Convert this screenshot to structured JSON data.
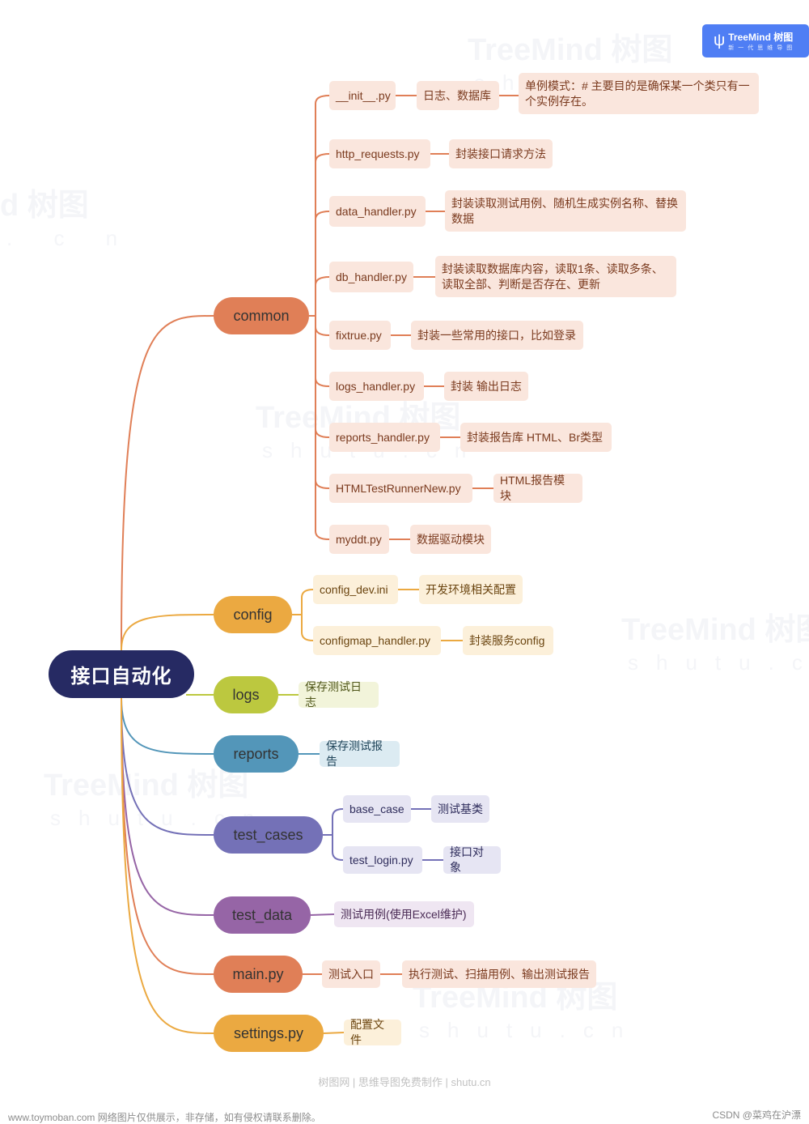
{
  "badge": {
    "brand": "TreeMind 树图",
    "tagline": "新一代思维导图",
    "icon": "treemind-logo-icon"
  },
  "watermark": {
    "brand": "TreeMind 树图",
    "domain": "shutu.cn",
    "partial_brand": "d 树图",
    "partial_domain": ". c n"
  },
  "colors": {
    "root_bg": "#262a63",
    "common": "#e07f57",
    "common_leaf": "#fae6dd",
    "common_text": "#7a3a1e",
    "config": "#eba941",
    "config_leaf": "#fcf0da",
    "config_text": "#6b4510",
    "logs": "#bcc83f",
    "logs_leaf": "#f2f4da",
    "logs_text": "#4f561a",
    "reports": "#5396b9",
    "reports_leaf": "#dcebf2",
    "reports_text": "#21455a",
    "test_cases": "#7471b7",
    "test_cases_leaf": "#e6e5f3",
    "test_cases_text": "#2f2d5c",
    "test_data": "#9665a6",
    "test_data_leaf": "#efe6f2",
    "test_data_text": "#4a2b55",
    "main": "#e07f57",
    "main_leaf": "#fae6dd",
    "main_text": "#7a3a1e",
    "settings": "#eba941",
    "settings_leaf": "#fcf0da",
    "settings_text": "#6b4510"
  },
  "mindmap": {
    "root": "接口自动化",
    "branches": [
      {
        "key": "common",
        "label": "common",
        "children": [
          {
            "label": "__init__.py",
            "children": [
              {
                "label": "日志、数据库",
                "children": [
                  {
                    "label": "单例模式：# 主要目的是确保某一个类只有一个实例存在。"
                  }
                ]
              }
            ]
          },
          {
            "label": "http_requests.py",
            "children": [
              {
                "label": "封装接口请求方法"
              }
            ]
          },
          {
            "label": "data_handler.py",
            "children": [
              {
                "label": "封装读取测试用例、随机生成实例名称、替换数据"
              }
            ]
          },
          {
            "label": "db_handler.py",
            "children": [
              {
                "label": "封装读取数据库内容，读取1条、读取多条、读取全部、判断是否存在、更新"
              }
            ]
          },
          {
            "label": "fixtrue.py",
            "children": [
              {
                "label": "封装一些常用的接口，比如登录"
              }
            ]
          },
          {
            "label": "logs_handler.py",
            "children": [
              {
                "label": "封装 输出日志"
              }
            ]
          },
          {
            "label": "reports_handler.py",
            "children": [
              {
                "label": "封装报告库 HTML、Br类型"
              }
            ]
          },
          {
            "label": "HTMLTestRunnerNew.py",
            "children": [
              {
                "label": "HTML报告模块"
              }
            ]
          },
          {
            "label": "myddt.py",
            "children": [
              {
                "label": "数据驱动模块"
              }
            ]
          }
        ]
      },
      {
        "key": "config",
        "label": "config",
        "children": [
          {
            "label": "config_dev.ini",
            "children": [
              {
                "label": "开发环境相关配置"
              }
            ]
          },
          {
            "label": "configmap_handler.py",
            "children": [
              {
                "label": "封装服务config"
              }
            ]
          }
        ]
      },
      {
        "key": "logs",
        "label": "logs",
        "children": [
          {
            "label": "保存测试日志"
          }
        ]
      },
      {
        "key": "reports",
        "label": "reports",
        "children": [
          {
            "label": "保存测试报告"
          }
        ]
      },
      {
        "key": "test_cases",
        "label": "test_cases",
        "children": [
          {
            "label": "base_case",
            "children": [
              {
                "label": "测试基类"
              }
            ]
          },
          {
            "label": "test_login.py",
            "children": [
              {
                "label": "接口对象"
              }
            ]
          }
        ]
      },
      {
        "key": "test_data",
        "label": "test_data",
        "children": [
          {
            "label": "测试用例(使用Excel维护)"
          }
        ]
      },
      {
        "key": "main",
        "label": "main.py",
        "children": [
          {
            "label": "测试入口",
            "children": [
              {
                "label": "执行测试、扫描用例、输出测试报告"
              }
            ]
          }
        ]
      },
      {
        "key": "settings",
        "label": "settings.py",
        "children": [
          {
            "label": "配置文件"
          }
        ]
      }
    ]
  },
  "footer": {
    "credit": "树图网 | 思维导图免费制作 | shutu.cn"
  },
  "page_notes": {
    "left": "www.toymoban.com 网络图片仅供展示，非存储，如有侵权请联系删除。",
    "right": "CSDN @菜鸡在沪漂"
  }
}
